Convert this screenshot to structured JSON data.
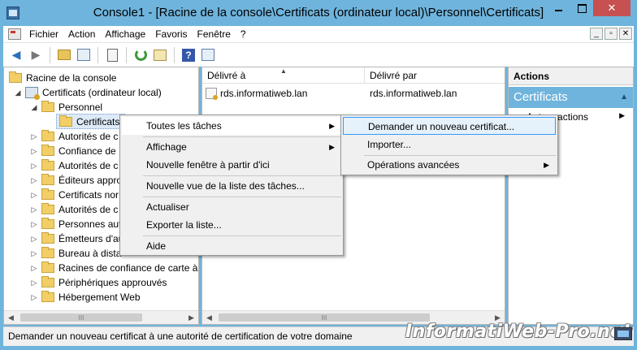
{
  "window": {
    "title": "Console1 - [Racine de la console\\Certificats (ordinateur local)\\Personnel\\Certificats]",
    "close_symbol": "✕",
    "accent_color": "#6fb4dc"
  },
  "menubar": {
    "items": [
      "Fichier",
      "Action",
      "Affichage",
      "Favoris",
      "Fenêtre",
      "?"
    ],
    "mdi_buttons": [
      "_",
      "▫",
      "✕"
    ]
  },
  "toolbar": {
    "icons": [
      "back-arrow-icon",
      "forward-arrow-icon",
      "up-folder-icon",
      "show-tree-icon",
      "clipboard-icon",
      "refresh-icon",
      "export-list-icon",
      "help-icon",
      "action-pane-icon"
    ],
    "help_glyph": "?"
  },
  "tree": {
    "items": [
      {
        "label": "Racine de la console",
        "level": 0,
        "expander": ""
      },
      {
        "label": "Certificats (ordinateur local)",
        "level": 1,
        "expander": "◢"
      },
      {
        "label": "Personnel",
        "level": 2,
        "expander": "◢"
      },
      {
        "label": "Certificats",
        "level": 3,
        "expander": ""
      },
      {
        "label": "Autorités de c",
        "level": 2,
        "expander": "▷"
      },
      {
        "label": "Confiance de",
        "level": 2,
        "expander": "▷"
      },
      {
        "label": "Autorités de c",
        "level": 2,
        "expander": "▷"
      },
      {
        "label": "Éditeurs appro",
        "level": 2,
        "expander": "▷"
      },
      {
        "label": "Certificats nor",
        "level": 2,
        "expander": "▷"
      },
      {
        "label": "Autorités de c",
        "level": 2,
        "expander": "▷"
      },
      {
        "label": "Personnes aut",
        "level": 2,
        "expander": "▷"
      },
      {
        "label": "Émetteurs d'au",
        "level": 2,
        "expander": "▷"
      },
      {
        "label": "Bureau à dista",
        "level": 2,
        "expander": "▷"
      },
      {
        "label": "Racines de confiance de carte à p",
        "level": 2,
        "expander": "▷"
      },
      {
        "label": "Périphériques approuvés",
        "level": 2,
        "expander": "▷"
      },
      {
        "label": "Hébergement Web",
        "level": 2,
        "expander": "▷"
      }
    ]
  },
  "scroll": {
    "left": "◀",
    "right": "▶",
    "thumb": "III"
  },
  "list": {
    "columns": [
      "Délivré à",
      "Délivré par"
    ],
    "sort_indicator": "▲",
    "rows": [
      {
        "issued_to": "rds.informatiweb.lan",
        "issued_by": "rds.informatiweb.lan"
      }
    ]
  },
  "actions": {
    "header": "Actions",
    "section": "Certificats",
    "section_toggle": "▲",
    "item": "Autres actions",
    "item_arrow": "▶"
  },
  "context_menu": {
    "items": [
      {
        "label": "Toutes les tâches",
        "submenu": "▶"
      },
      {
        "label": "Affichage",
        "submenu": "▶"
      },
      {
        "label": "Nouvelle fenêtre à partir d'ici",
        "submenu": ""
      },
      {
        "label": "Nouvelle vue de la liste des tâches...",
        "submenu": ""
      },
      {
        "label": "Actualiser",
        "submenu": ""
      },
      {
        "label": "Exporter la liste...",
        "submenu": ""
      },
      {
        "label": "Aide",
        "submenu": ""
      }
    ]
  },
  "submenu": {
    "items": [
      {
        "label": "Demander un nouveau certificat...",
        "submenu": ""
      },
      {
        "label": "Importer...",
        "submenu": ""
      },
      {
        "label": "Opérations avancées",
        "submenu": "▶"
      }
    ]
  },
  "statusbar": {
    "text": "Demander un nouveau certificat à une autorité de certification de votre domaine"
  },
  "watermark": {
    "text": "InformatiWeb-Pro.net"
  }
}
